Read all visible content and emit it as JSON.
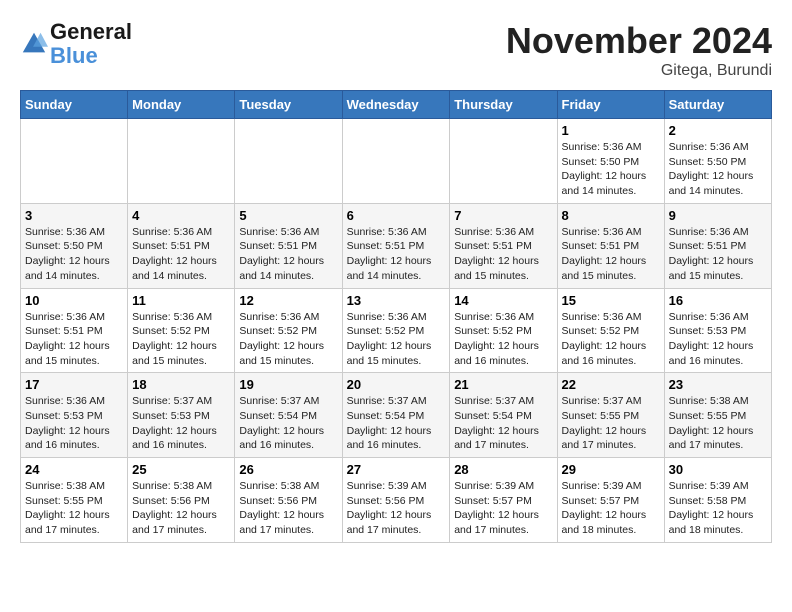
{
  "logo": {
    "line1": "General",
    "line2": "Blue"
  },
  "title": "November 2024",
  "location": "Gitega, Burundi",
  "days_of_week": [
    "Sunday",
    "Monday",
    "Tuesday",
    "Wednesday",
    "Thursday",
    "Friday",
    "Saturday"
  ],
  "weeks": [
    [
      {
        "day": "",
        "info": ""
      },
      {
        "day": "",
        "info": ""
      },
      {
        "day": "",
        "info": ""
      },
      {
        "day": "",
        "info": ""
      },
      {
        "day": "",
        "info": ""
      },
      {
        "day": "1",
        "info": "Sunrise: 5:36 AM\nSunset: 5:50 PM\nDaylight: 12 hours\nand 14 minutes."
      },
      {
        "day": "2",
        "info": "Sunrise: 5:36 AM\nSunset: 5:50 PM\nDaylight: 12 hours\nand 14 minutes."
      }
    ],
    [
      {
        "day": "3",
        "info": "Sunrise: 5:36 AM\nSunset: 5:50 PM\nDaylight: 12 hours\nand 14 minutes."
      },
      {
        "day": "4",
        "info": "Sunrise: 5:36 AM\nSunset: 5:51 PM\nDaylight: 12 hours\nand 14 minutes."
      },
      {
        "day": "5",
        "info": "Sunrise: 5:36 AM\nSunset: 5:51 PM\nDaylight: 12 hours\nand 14 minutes."
      },
      {
        "day": "6",
        "info": "Sunrise: 5:36 AM\nSunset: 5:51 PM\nDaylight: 12 hours\nand 14 minutes."
      },
      {
        "day": "7",
        "info": "Sunrise: 5:36 AM\nSunset: 5:51 PM\nDaylight: 12 hours\nand 15 minutes."
      },
      {
        "day": "8",
        "info": "Sunrise: 5:36 AM\nSunset: 5:51 PM\nDaylight: 12 hours\nand 15 minutes."
      },
      {
        "day": "9",
        "info": "Sunrise: 5:36 AM\nSunset: 5:51 PM\nDaylight: 12 hours\nand 15 minutes."
      }
    ],
    [
      {
        "day": "10",
        "info": "Sunrise: 5:36 AM\nSunset: 5:51 PM\nDaylight: 12 hours\nand 15 minutes."
      },
      {
        "day": "11",
        "info": "Sunrise: 5:36 AM\nSunset: 5:52 PM\nDaylight: 12 hours\nand 15 minutes."
      },
      {
        "day": "12",
        "info": "Sunrise: 5:36 AM\nSunset: 5:52 PM\nDaylight: 12 hours\nand 15 minutes."
      },
      {
        "day": "13",
        "info": "Sunrise: 5:36 AM\nSunset: 5:52 PM\nDaylight: 12 hours\nand 15 minutes."
      },
      {
        "day": "14",
        "info": "Sunrise: 5:36 AM\nSunset: 5:52 PM\nDaylight: 12 hours\nand 16 minutes."
      },
      {
        "day": "15",
        "info": "Sunrise: 5:36 AM\nSunset: 5:52 PM\nDaylight: 12 hours\nand 16 minutes."
      },
      {
        "day": "16",
        "info": "Sunrise: 5:36 AM\nSunset: 5:53 PM\nDaylight: 12 hours\nand 16 minutes."
      }
    ],
    [
      {
        "day": "17",
        "info": "Sunrise: 5:36 AM\nSunset: 5:53 PM\nDaylight: 12 hours\nand 16 minutes."
      },
      {
        "day": "18",
        "info": "Sunrise: 5:37 AM\nSunset: 5:53 PM\nDaylight: 12 hours\nand 16 minutes."
      },
      {
        "day": "19",
        "info": "Sunrise: 5:37 AM\nSunset: 5:54 PM\nDaylight: 12 hours\nand 16 minutes."
      },
      {
        "day": "20",
        "info": "Sunrise: 5:37 AM\nSunset: 5:54 PM\nDaylight: 12 hours\nand 16 minutes."
      },
      {
        "day": "21",
        "info": "Sunrise: 5:37 AM\nSunset: 5:54 PM\nDaylight: 12 hours\nand 17 minutes."
      },
      {
        "day": "22",
        "info": "Sunrise: 5:37 AM\nSunset: 5:55 PM\nDaylight: 12 hours\nand 17 minutes."
      },
      {
        "day": "23",
        "info": "Sunrise: 5:38 AM\nSunset: 5:55 PM\nDaylight: 12 hours\nand 17 minutes."
      }
    ],
    [
      {
        "day": "24",
        "info": "Sunrise: 5:38 AM\nSunset: 5:55 PM\nDaylight: 12 hours\nand 17 minutes."
      },
      {
        "day": "25",
        "info": "Sunrise: 5:38 AM\nSunset: 5:56 PM\nDaylight: 12 hours\nand 17 minutes."
      },
      {
        "day": "26",
        "info": "Sunrise: 5:38 AM\nSunset: 5:56 PM\nDaylight: 12 hours\nand 17 minutes."
      },
      {
        "day": "27",
        "info": "Sunrise: 5:39 AM\nSunset: 5:56 PM\nDaylight: 12 hours\nand 17 minutes."
      },
      {
        "day": "28",
        "info": "Sunrise: 5:39 AM\nSunset: 5:57 PM\nDaylight: 12 hours\nand 17 minutes."
      },
      {
        "day": "29",
        "info": "Sunrise: 5:39 AM\nSunset: 5:57 PM\nDaylight: 12 hours\nand 18 minutes."
      },
      {
        "day": "30",
        "info": "Sunrise: 5:39 AM\nSunset: 5:58 PM\nDaylight: 12 hours\nand 18 minutes."
      }
    ]
  ]
}
